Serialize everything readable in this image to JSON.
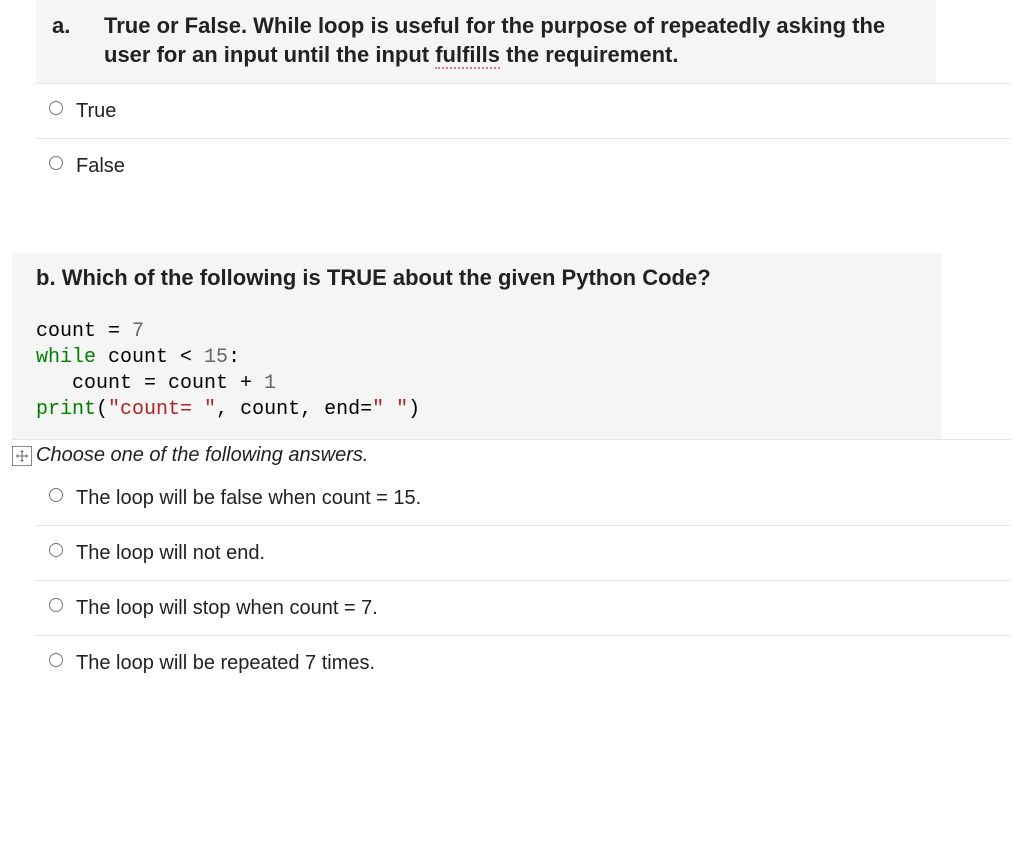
{
  "question_a": {
    "marker": "a.",
    "title_before": "True or False. While loop is useful for the purpose of repeatedly asking the user for an input until the input ",
    "title_spell": "fulfills",
    "title_after": " the requirement.",
    "options": [
      {
        "label": "True"
      },
      {
        "label": "False"
      }
    ]
  },
  "question_b": {
    "marker": "b.",
    "title": "Which of the following is TRUE about the given Python Code?",
    "code": {
      "l1_a": "count = ",
      "l1_b": "7",
      "l2_a": "while",
      "l2_b": " count < ",
      "l2_c": "15",
      "l2_d": ":",
      "l3": "   count = count + ",
      "l3_b": "1",
      "l4_a": "print",
      "l4_b": "(",
      "l4_c": "\"count= \"",
      "l4_d": ", count, end=",
      "l4_e": "\" \"",
      "l4_f": ")"
    },
    "instruction": "Choose one of the following answers.",
    "options": [
      {
        "label": "The loop will be false when count = 15."
      },
      {
        "label": "The loop will not end."
      },
      {
        "label": "The loop will stop when count = 7."
      },
      {
        "label": "The loop will be repeated 7 times."
      }
    ]
  }
}
